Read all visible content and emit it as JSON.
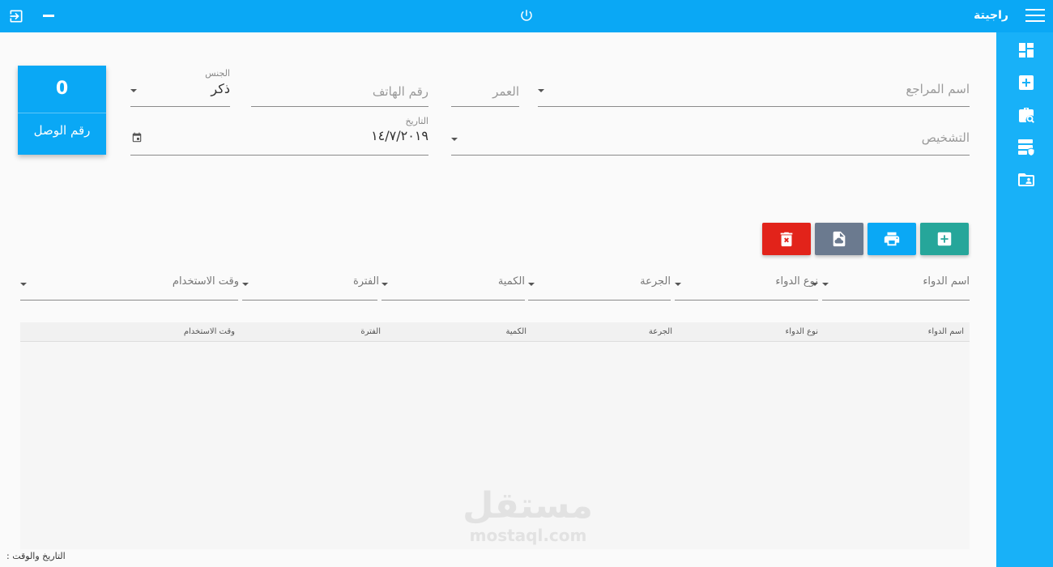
{
  "topbar": {
    "app_title": "راجيتة",
    "bg_color": "#0aa8f5",
    "icons": [
      "exit-icon",
      "minimize-icon",
      "power-icon",
      "menu-icon"
    ]
  },
  "sidebar": {
    "bg_color": "#18b1f8",
    "items": [
      {
        "icon": "dashboard-icon"
      },
      {
        "icon": "add-box-icon"
      },
      {
        "icon": "medical-bag-search-icon"
      },
      {
        "icon": "server-shield-icon"
      },
      {
        "icon": "folder-user-icon"
      }
    ]
  },
  "receipt": {
    "value": "0",
    "label": "رقم الوصل"
  },
  "form": {
    "patient_name_placeholder": "اسم المراجع",
    "age_placeholder": "العمر",
    "phone_placeholder": "رقم الهاتف",
    "gender_label": "الجنس",
    "gender_value": "ذكر",
    "diagnosis_placeholder": "التشخيص",
    "date_label": "التاريخ",
    "date_value": "١٤/٧/٢٠١٩"
  },
  "actions": {
    "colors": {
      "add": "#26a69a",
      "print": "#0aa8f5",
      "save": "#6b7a8f",
      "delete": "#e2231a"
    },
    "icons": [
      "add-box-icon",
      "print-icon",
      "file-cloud-icon",
      "delete-icon"
    ]
  },
  "med_fields": {
    "medicine_name": "اسم الدواء",
    "medicine_type": "نوع الدواء",
    "dose": "الجرعة",
    "quantity": "الكمية",
    "period": "الفترة",
    "usage_time": "وقت الاستخدام"
  },
  "table": {
    "columns": [
      "اسم الدواء",
      "نوع الدواء",
      "الجرعة",
      "الكمية",
      "الفترة",
      "وقت الاستخدام"
    ]
  },
  "watermark": {
    "arabic": "مستقل",
    "latin": "mostaql.com"
  },
  "footer": {
    "datetime_label": "التاريخ والوقت :"
  }
}
